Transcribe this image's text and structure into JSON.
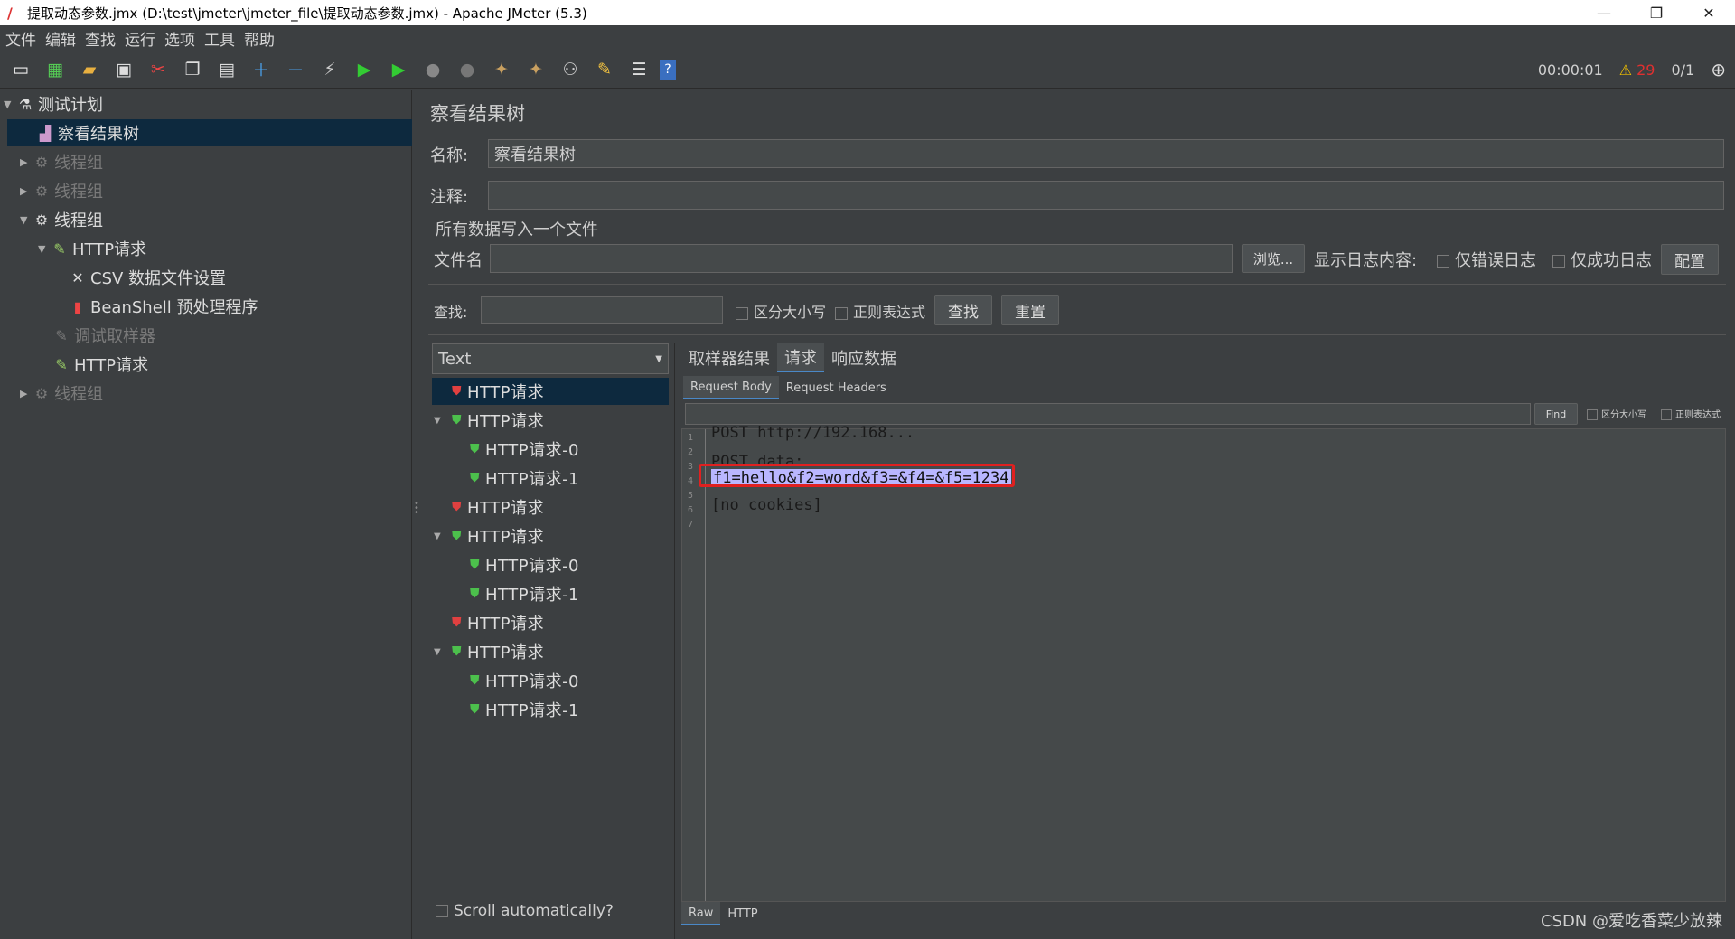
{
  "window": {
    "title": "提取动态参数.jmx (D:\\test\\jmeter\\jmeter_file\\提取动态参数.jmx) - Apache JMeter (5.3)"
  },
  "menu": [
    "文件",
    "编辑",
    "查找",
    "运行",
    "选项",
    "工具",
    "帮助"
  ],
  "toolbar": {
    "timer": "00:00:01",
    "warnings": "29",
    "threads": "0/1"
  },
  "tree": {
    "items": [
      {
        "label": "测试计划"
      },
      {
        "label": "察看结果树"
      },
      {
        "label": "线程组"
      },
      {
        "label": "线程组"
      },
      {
        "label": "线程组"
      },
      {
        "label": "HTTP请求"
      },
      {
        "label": "CSV 数据文件设置"
      },
      {
        "label": "BeanShell 预处理程序"
      },
      {
        "label": "调试取样器"
      },
      {
        "label": "HTTP请求"
      },
      {
        "label": "线程组"
      }
    ]
  },
  "panel": {
    "title": "察看结果树",
    "name_label": "名称:",
    "name_value": "察看结果树",
    "comment_label": "注释:",
    "write_all": "所有数据写入一个文件",
    "filename_label": "文件名",
    "browse": "浏览...",
    "log_display": "显示日志内容:",
    "errors_only": "仅错误日志",
    "success_only": "仅成功日志",
    "configure": "配置",
    "search_label": "查找:",
    "case_sensitive": "区分大小写",
    "regex": "正则表达式",
    "find": "查找",
    "reset": "重置"
  },
  "renderer": {
    "selected": "Text"
  },
  "results": [
    {
      "label": "HTTP请求"
    },
    {
      "label": "HTTP请求"
    },
    {
      "label": "HTTP请求-0"
    },
    {
      "label": "HTTP请求-1"
    },
    {
      "label": "HTTP请求"
    },
    {
      "label": "HTTP请求"
    },
    {
      "label": "HTTP请求-0"
    },
    {
      "label": "HTTP请求-1"
    },
    {
      "label": "HTTP请求"
    },
    {
      "label": "HTTP请求"
    },
    {
      "label": "HTTP请求-0"
    },
    {
      "label": "HTTP请求-1"
    }
  ],
  "scroll_auto": "Scroll automatically?",
  "tabs": [
    "取样器结果",
    "请求",
    "响应数据"
  ],
  "subtabs": [
    "Request Body",
    "Request Headers"
  ],
  "editor": {
    "find_btn": "Find",
    "case_small": "区分大小写",
    "regex_small": "正则表达式",
    "lines": [
      "1",
      "2",
      "3",
      "4",
      "5",
      "6",
      "7"
    ],
    "line1": "POST http://192.168...",
    "line3": "POST data:",
    "line4": "f1=hello&f2=word&f3=&f4=&f5=1234",
    "line6": "[no cookies]"
  },
  "bottom_tabs": [
    "Raw",
    "HTTP"
  ],
  "watermark": "CSDN @爱吃香菜少放辣"
}
